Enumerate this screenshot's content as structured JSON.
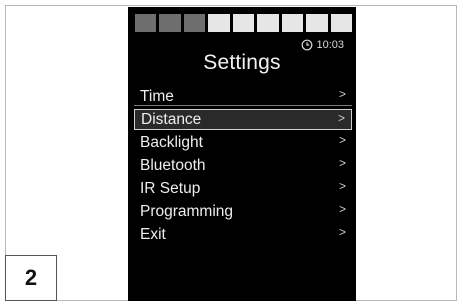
{
  "step_number": "2",
  "device": {
    "battery": {
      "segments_total": 9,
      "segments_filled": 6
    },
    "clock": {
      "icon": "clock-icon",
      "time": "10:03"
    },
    "title": "Settings",
    "menu": [
      {
        "label": "Time",
        "arrow": ">",
        "selected": false
      },
      {
        "label": "Distance",
        "arrow": ">",
        "selected": true
      },
      {
        "label": "Backlight",
        "arrow": ">",
        "selected": false
      },
      {
        "label": "Bluetooth",
        "arrow": ">",
        "selected": false
      },
      {
        "label": "IR Setup",
        "arrow": ">",
        "selected": false
      },
      {
        "label": "Programming",
        "arrow": ">",
        "selected": false
      },
      {
        "label": "Exit",
        "arrow": ">",
        "selected": false
      }
    ]
  },
  "colors": {
    "screen_bg": "#000000",
    "text": "#ededed",
    "battery_full": "#e6e6e6",
    "battery_empty": "#6e6e6e"
  }
}
